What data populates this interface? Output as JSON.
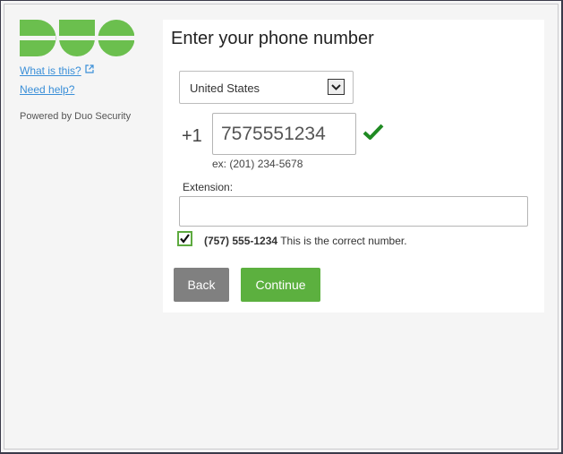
{
  "brand": {
    "logo_icon": "duo-logo",
    "logo_color": "#6bbf4e"
  },
  "sidebar": {
    "what_is_this": "What is this?",
    "need_help": "Need help?",
    "powered_by": "Powered by Duo Security",
    "link_color": "#3a8fd8"
  },
  "form": {
    "title": "Enter your phone number",
    "country": "United States",
    "country_code": "+1",
    "phone_value": "7575551234",
    "phone_valid_icon": "checkmark-icon",
    "example": "ex: (201) 234-5678",
    "extension_label": "Extension:",
    "extension_value": "",
    "confirm_checked": true,
    "confirm_number": "(757) 555-1234",
    "confirm_text": "This is the correct number.",
    "back_label": "Back",
    "continue_label": "Continue",
    "accent_color": "#5cb03f"
  }
}
